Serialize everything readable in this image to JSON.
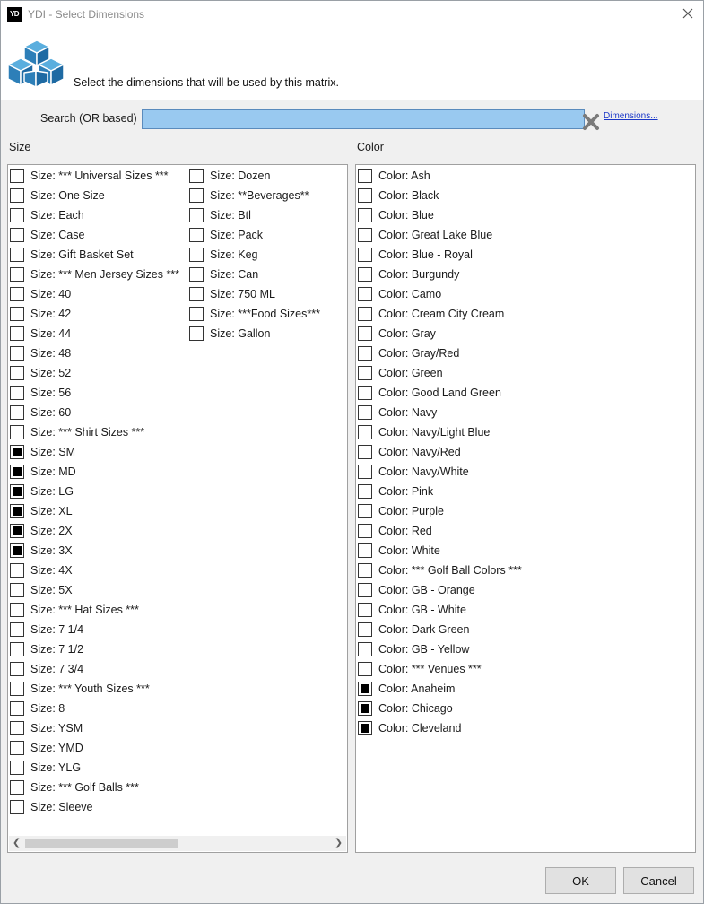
{
  "window": {
    "icon_text": "YD",
    "title": "YDI - Select Dimensions"
  },
  "header": {
    "message": "Select the dimensions that will be used by this matrix."
  },
  "search": {
    "label": "Search (OR based)",
    "value": "",
    "dimensions_link": "Dimensions..."
  },
  "size": {
    "label": "Size",
    "col1": [
      {
        "label": "Size: *** Universal Sizes ***",
        "checked": false
      },
      {
        "label": "Size: One Size",
        "checked": false
      },
      {
        "label": "Size: Each",
        "checked": false
      },
      {
        "label": "Size: Case",
        "checked": false
      },
      {
        "label": "Size: Gift Basket Set",
        "checked": false
      },
      {
        "label": "Size: *** Men Jersey Sizes ***",
        "checked": false
      },
      {
        "label": "Size: 40",
        "checked": false
      },
      {
        "label": "Size: 42",
        "checked": false
      },
      {
        "label": "Size: 44",
        "checked": false
      },
      {
        "label": "Size: 48",
        "checked": false
      },
      {
        "label": "Size: 52",
        "checked": false
      },
      {
        "label": "Size: 56",
        "checked": false
      },
      {
        "label": "Size: 60",
        "checked": false
      },
      {
        "label": "Size: *** Shirt Sizes ***",
        "checked": false
      },
      {
        "label": "Size: SM",
        "checked": true
      },
      {
        "label": "Size: MD",
        "checked": true
      },
      {
        "label": "Size: LG",
        "checked": true
      },
      {
        "label": "Size: XL",
        "checked": true
      },
      {
        "label": "Size: 2X",
        "checked": true
      },
      {
        "label": "Size: 3X",
        "checked": true
      },
      {
        "label": "Size: 4X",
        "checked": false
      },
      {
        "label": "Size: 5X",
        "checked": false
      },
      {
        "label": "Size: *** Hat Sizes ***",
        "checked": false
      },
      {
        "label": "Size: 7 1/4",
        "checked": false
      },
      {
        "label": "Size: 7 1/2",
        "checked": false
      },
      {
        "label": "Size: 7 3/4",
        "checked": false
      },
      {
        "label": "Size: *** Youth Sizes ***",
        "checked": false
      },
      {
        "label": "Size: 8",
        "checked": false
      },
      {
        "label": "Size: YSM",
        "checked": false
      },
      {
        "label": "Size: YMD",
        "checked": false
      },
      {
        "label": "Size: YLG",
        "checked": false
      },
      {
        "label": "Size: *** Golf Balls ***",
        "checked": false
      },
      {
        "label": "Size: Sleeve",
        "checked": false
      }
    ],
    "col2": [
      {
        "label": "Size: Dozen",
        "checked": false
      },
      {
        "label": "Size: **Beverages**",
        "checked": false
      },
      {
        "label": "Size: Btl",
        "checked": false
      },
      {
        "label": "Size: Pack",
        "checked": false
      },
      {
        "label": "Size: Keg",
        "checked": false
      },
      {
        "label": "Size: Can",
        "checked": false
      },
      {
        "label": "Size: 750 ML",
        "checked": false
      },
      {
        "label": "Size: ***Food Sizes***",
        "checked": false
      },
      {
        "label": "Size: Gallon",
        "checked": false
      }
    ]
  },
  "color": {
    "label": "Color",
    "items": [
      {
        "label": "Color: Ash",
        "checked": false
      },
      {
        "label": "Color: Black",
        "checked": false
      },
      {
        "label": "Color: Blue",
        "checked": false
      },
      {
        "label": "Color: Great Lake Blue",
        "checked": false
      },
      {
        "label": "Color: Blue - Royal",
        "checked": false
      },
      {
        "label": "Color: Burgundy",
        "checked": false
      },
      {
        "label": "Color: Camo",
        "checked": false
      },
      {
        "label": "Color: Cream City Cream",
        "checked": false
      },
      {
        "label": "Color: Gray",
        "checked": false
      },
      {
        "label": "Color: Gray/Red",
        "checked": false
      },
      {
        "label": "Color: Green",
        "checked": false
      },
      {
        "label": "Color: Good Land Green",
        "checked": false
      },
      {
        "label": "Color: Navy",
        "checked": false
      },
      {
        "label": "Color: Navy/Light Blue",
        "checked": false
      },
      {
        "label": "Color: Navy/Red",
        "checked": false
      },
      {
        "label": "Color: Navy/White",
        "checked": false
      },
      {
        "label": "Color: Pink",
        "checked": false
      },
      {
        "label": "Color: Purple",
        "checked": false
      },
      {
        "label": "Color: Red",
        "checked": false
      },
      {
        "label": "Color: White",
        "checked": false
      },
      {
        "label": "Color: *** Golf Ball Colors ***",
        "checked": false
      },
      {
        "label": "Color: GB - Orange",
        "checked": false
      },
      {
        "label": "Color: GB - White",
        "checked": false
      },
      {
        "label": "Color: Dark Green",
        "checked": false
      },
      {
        "label": "Color: GB - Yellow",
        "checked": false
      },
      {
        "label": "Color: *** Venues ***",
        "checked": false
      },
      {
        "label": "Color: Anaheim",
        "checked": true
      },
      {
        "label": "Color: Chicago",
        "checked": true
      },
      {
        "label": "Color: Cleveland",
        "checked": true
      }
    ]
  },
  "buttons": {
    "ok": "OK",
    "cancel": "Cancel"
  },
  "colors": {
    "search_bg": "#99c9f0",
    "link": "#1a37c8",
    "check_fill": "#000000"
  }
}
